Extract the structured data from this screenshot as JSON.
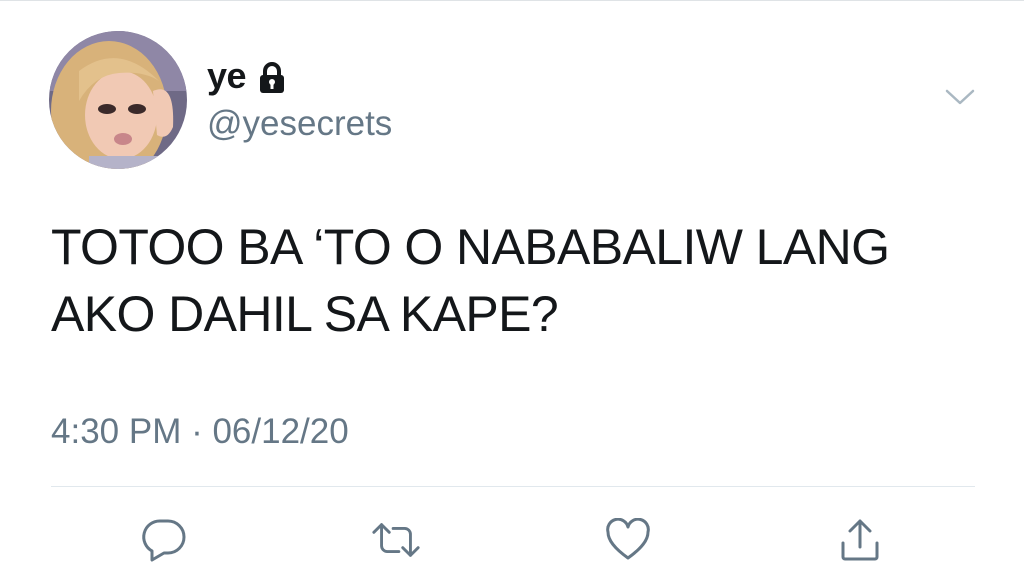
{
  "tweet": {
    "display_name": "ye",
    "handle": "@yesecrets",
    "text_line1": "TOTOO BA ‘TO O NABABALIW LANG",
    "text_line2": "AKO DAHIL SA KAPE?",
    "timestamp": "4:30 PM · 06/12/20",
    "protected": true
  },
  "icons": {
    "lock": "lock-icon",
    "menu": "chevron-down-icon",
    "reply": "reply-icon",
    "retweet": "retweet-icon",
    "like": "heart-icon",
    "share": "share-icon"
  },
  "colors": {
    "text": "#14171a",
    "secondary": "#657786",
    "divider": "#e1e8ed"
  }
}
